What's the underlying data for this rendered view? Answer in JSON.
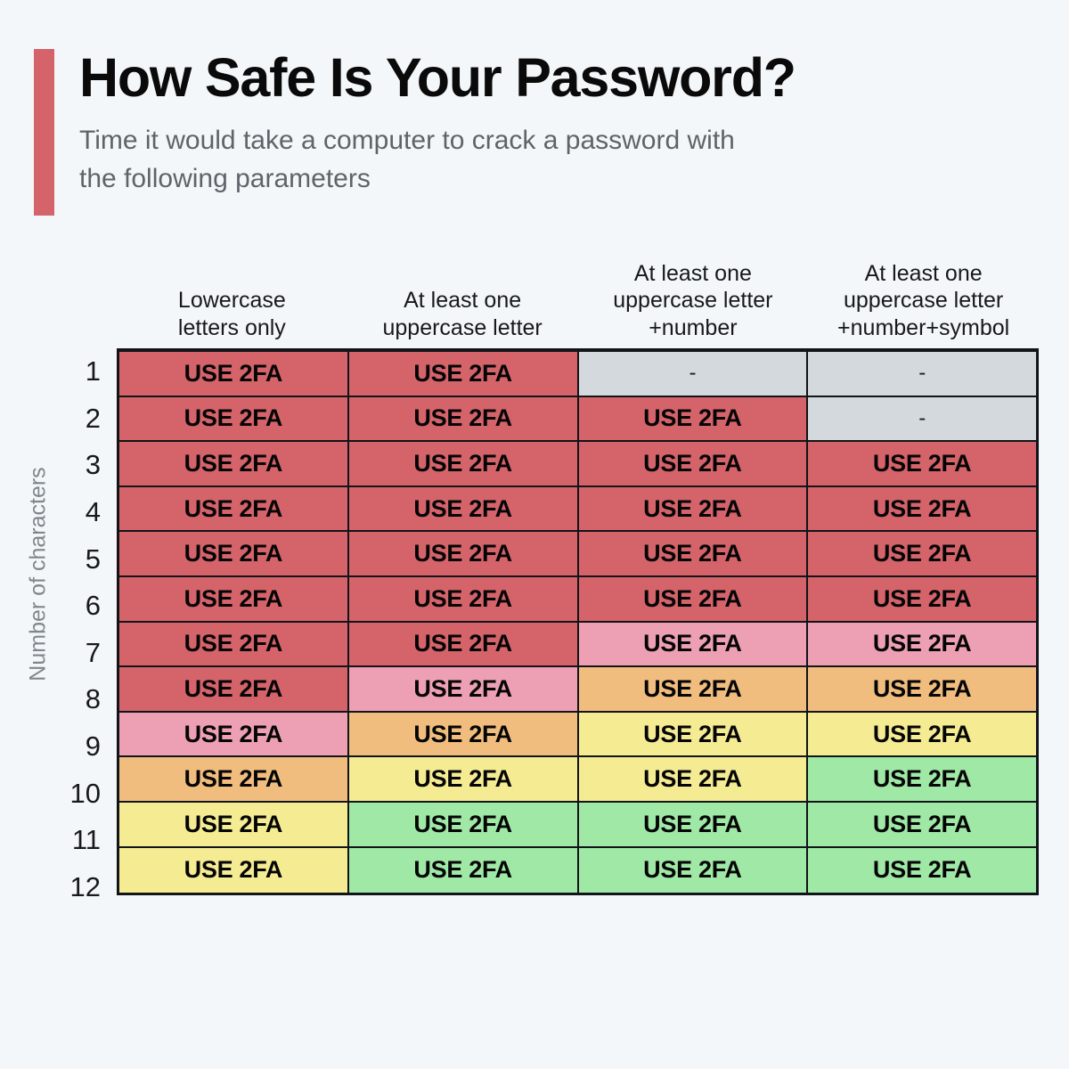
{
  "header": {
    "title": "How Safe Is Your Password?",
    "subtitle": "Time it would take a computer to crack a password with the following parameters",
    "accent_color": "#d4636a"
  },
  "axes": {
    "y_axis_title": "Number of characters"
  },
  "chart_data": {
    "type": "heatmap",
    "title": "How Safe Is Your Password?",
    "subtitle": "Time it would take a computer to crack a password with the following parameters",
    "xlabel": "",
    "ylabel": "Number of characters",
    "grid": true,
    "legend": "none",
    "categories": [
      "Lowercase letters only",
      "At least one uppercase letter",
      "At least one uppercase letter +number",
      "At least one uppercase letter +number+symbol"
    ],
    "column_headers": [
      [
        "Lowercase",
        "letters only"
      ],
      [
        "At least one",
        "uppercase letter"
      ],
      [
        "At least one",
        "uppercase letter",
        "+number"
      ],
      [
        "At least one",
        "uppercase letter",
        "+number+symbol"
      ]
    ],
    "row_labels": [
      "1",
      "2",
      "3",
      "4",
      "5",
      "6",
      "7",
      "8",
      "9",
      "10",
      "11",
      "12"
    ],
    "cell_label": "USE 2FA",
    "na_label": "-",
    "color_legend": {
      "na": "#d3d9dd",
      "red": "#d4636a",
      "pink": "#eda0b4",
      "orange": "#f0bd7e",
      "yellow": "#f5eb93",
      "green": "#9fe8a6"
    },
    "rows": [
      {
        "label": "1",
        "cells": [
          {
            "text": "USE 2FA",
            "color": "#d4636a",
            "level": "red"
          },
          {
            "text": "USE 2FA",
            "color": "#d4636a",
            "level": "red"
          },
          {
            "text": "-",
            "color": "#d3d9dd",
            "level": "na"
          },
          {
            "text": "-",
            "color": "#d3d9dd",
            "level": "na"
          }
        ]
      },
      {
        "label": "2",
        "cells": [
          {
            "text": "USE 2FA",
            "color": "#d4636a",
            "level": "red"
          },
          {
            "text": "USE 2FA",
            "color": "#d4636a",
            "level": "red"
          },
          {
            "text": "USE 2FA",
            "color": "#d4636a",
            "level": "red"
          },
          {
            "text": "-",
            "color": "#d3d9dd",
            "level": "na"
          }
        ]
      },
      {
        "label": "3",
        "cells": [
          {
            "text": "USE 2FA",
            "color": "#d4636a",
            "level": "red"
          },
          {
            "text": "USE 2FA",
            "color": "#d4636a",
            "level": "red"
          },
          {
            "text": "USE 2FA",
            "color": "#d4636a",
            "level": "red"
          },
          {
            "text": "USE 2FA",
            "color": "#d4636a",
            "level": "red"
          }
        ]
      },
      {
        "label": "4",
        "cells": [
          {
            "text": "USE 2FA",
            "color": "#d4636a",
            "level": "red"
          },
          {
            "text": "USE 2FA",
            "color": "#d4636a",
            "level": "red"
          },
          {
            "text": "USE 2FA",
            "color": "#d4636a",
            "level": "red"
          },
          {
            "text": "USE 2FA",
            "color": "#d4636a",
            "level": "red"
          }
        ]
      },
      {
        "label": "5",
        "cells": [
          {
            "text": "USE 2FA",
            "color": "#d4636a",
            "level": "red"
          },
          {
            "text": "USE 2FA",
            "color": "#d4636a",
            "level": "red"
          },
          {
            "text": "USE 2FA",
            "color": "#d4636a",
            "level": "red"
          },
          {
            "text": "USE 2FA",
            "color": "#d4636a",
            "level": "red"
          }
        ]
      },
      {
        "label": "6",
        "cells": [
          {
            "text": "USE 2FA",
            "color": "#d4636a",
            "level": "red"
          },
          {
            "text": "USE 2FA",
            "color": "#d4636a",
            "level": "red"
          },
          {
            "text": "USE 2FA",
            "color": "#d4636a",
            "level": "red"
          },
          {
            "text": "USE 2FA",
            "color": "#d4636a",
            "level": "red"
          }
        ]
      },
      {
        "label": "7",
        "cells": [
          {
            "text": "USE 2FA",
            "color": "#d4636a",
            "level": "red"
          },
          {
            "text": "USE 2FA",
            "color": "#d4636a",
            "level": "red"
          },
          {
            "text": "USE 2FA",
            "color": "#eda0b4",
            "level": "pink"
          },
          {
            "text": "USE 2FA",
            "color": "#eda0b4",
            "level": "pink"
          }
        ]
      },
      {
        "label": "8",
        "cells": [
          {
            "text": "USE 2FA",
            "color": "#d4636a",
            "level": "red"
          },
          {
            "text": "USE 2FA",
            "color": "#eda0b4",
            "level": "pink"
          },
          {
            "text": "USE 2FA",
            "color": "#f0bd7e",
            "level": "orange"
          },
          {
            "text": "USE 2FA",
            "color": "#f0bd7e",
            "level": "orange"
          }
        ]
      },
      {
        "label": "9",
        "cells": [
          {
            "text": "USE 2FA",
            "color": "#eda0b4",
            "level": "pink"
          },
          {
            "text": "USE 2FA",
            "color": "#f0bd7e",
            "level": "orange"
          },
          {
            "text": "USE 2FA",
            "color": "#f5eb93",
            "level": "yellow"
          },
          {
            "text": "USE 2FA",
            "color": "#f5eb93",
            "level": "yellow"
          }
        ]
      },
      {
        "label": "10",
        "cells": [
          {
            "text": "USE 2FA",
            "color": "#f0bd7e",
            "level": "orange"
          },
          {
            "text": "USE 2FA",
            "color": "#f5eb93",
            "level": "yellow"
          },
          {
            "text": "USE 2FA",
            "color": "#f5eb93",
            "level": "yellow"
          },
          {
            "text": "USE 2FA",
            "color": "#9fe8a6",
            "level": "green"
          }
        ]
      },
      {
        "label": "11",
        "cells": [
          {
            "text": "USE 2FA",
            "color": "#f5eb93",
            "level": "yellow"
          },
          {
            "text": "USE 2FA",
            "color": "#9fe8a6",
            "level": "green"
          },
          {
            "text": "USE 2FA",
            "color": "#9fe8a6",
            "level": "green"
          },
          {
            "text": "USE 2FA",
            "color": "#9fe8a6",
            "level": "green"
          }
        ]
      },
      {
        "label": "12",
        "cells": [
          {
            "text": "USE 2FA",
            "color": "#f5eb93",
            "level": "yellow"
          },
          {
            "text": "USE 2FA",
            "color": "#9fe8a6",
            "level": "green"
          },
          {
            "text": "USE 2FA",
            "color": "#9fe8a6",
            "level": "green"
          },
          {
            "text": "USE 2FA",
            "color": "#9fe8a6",
            "level": "green"
          }
        ]
      }
    ]
  }
}
